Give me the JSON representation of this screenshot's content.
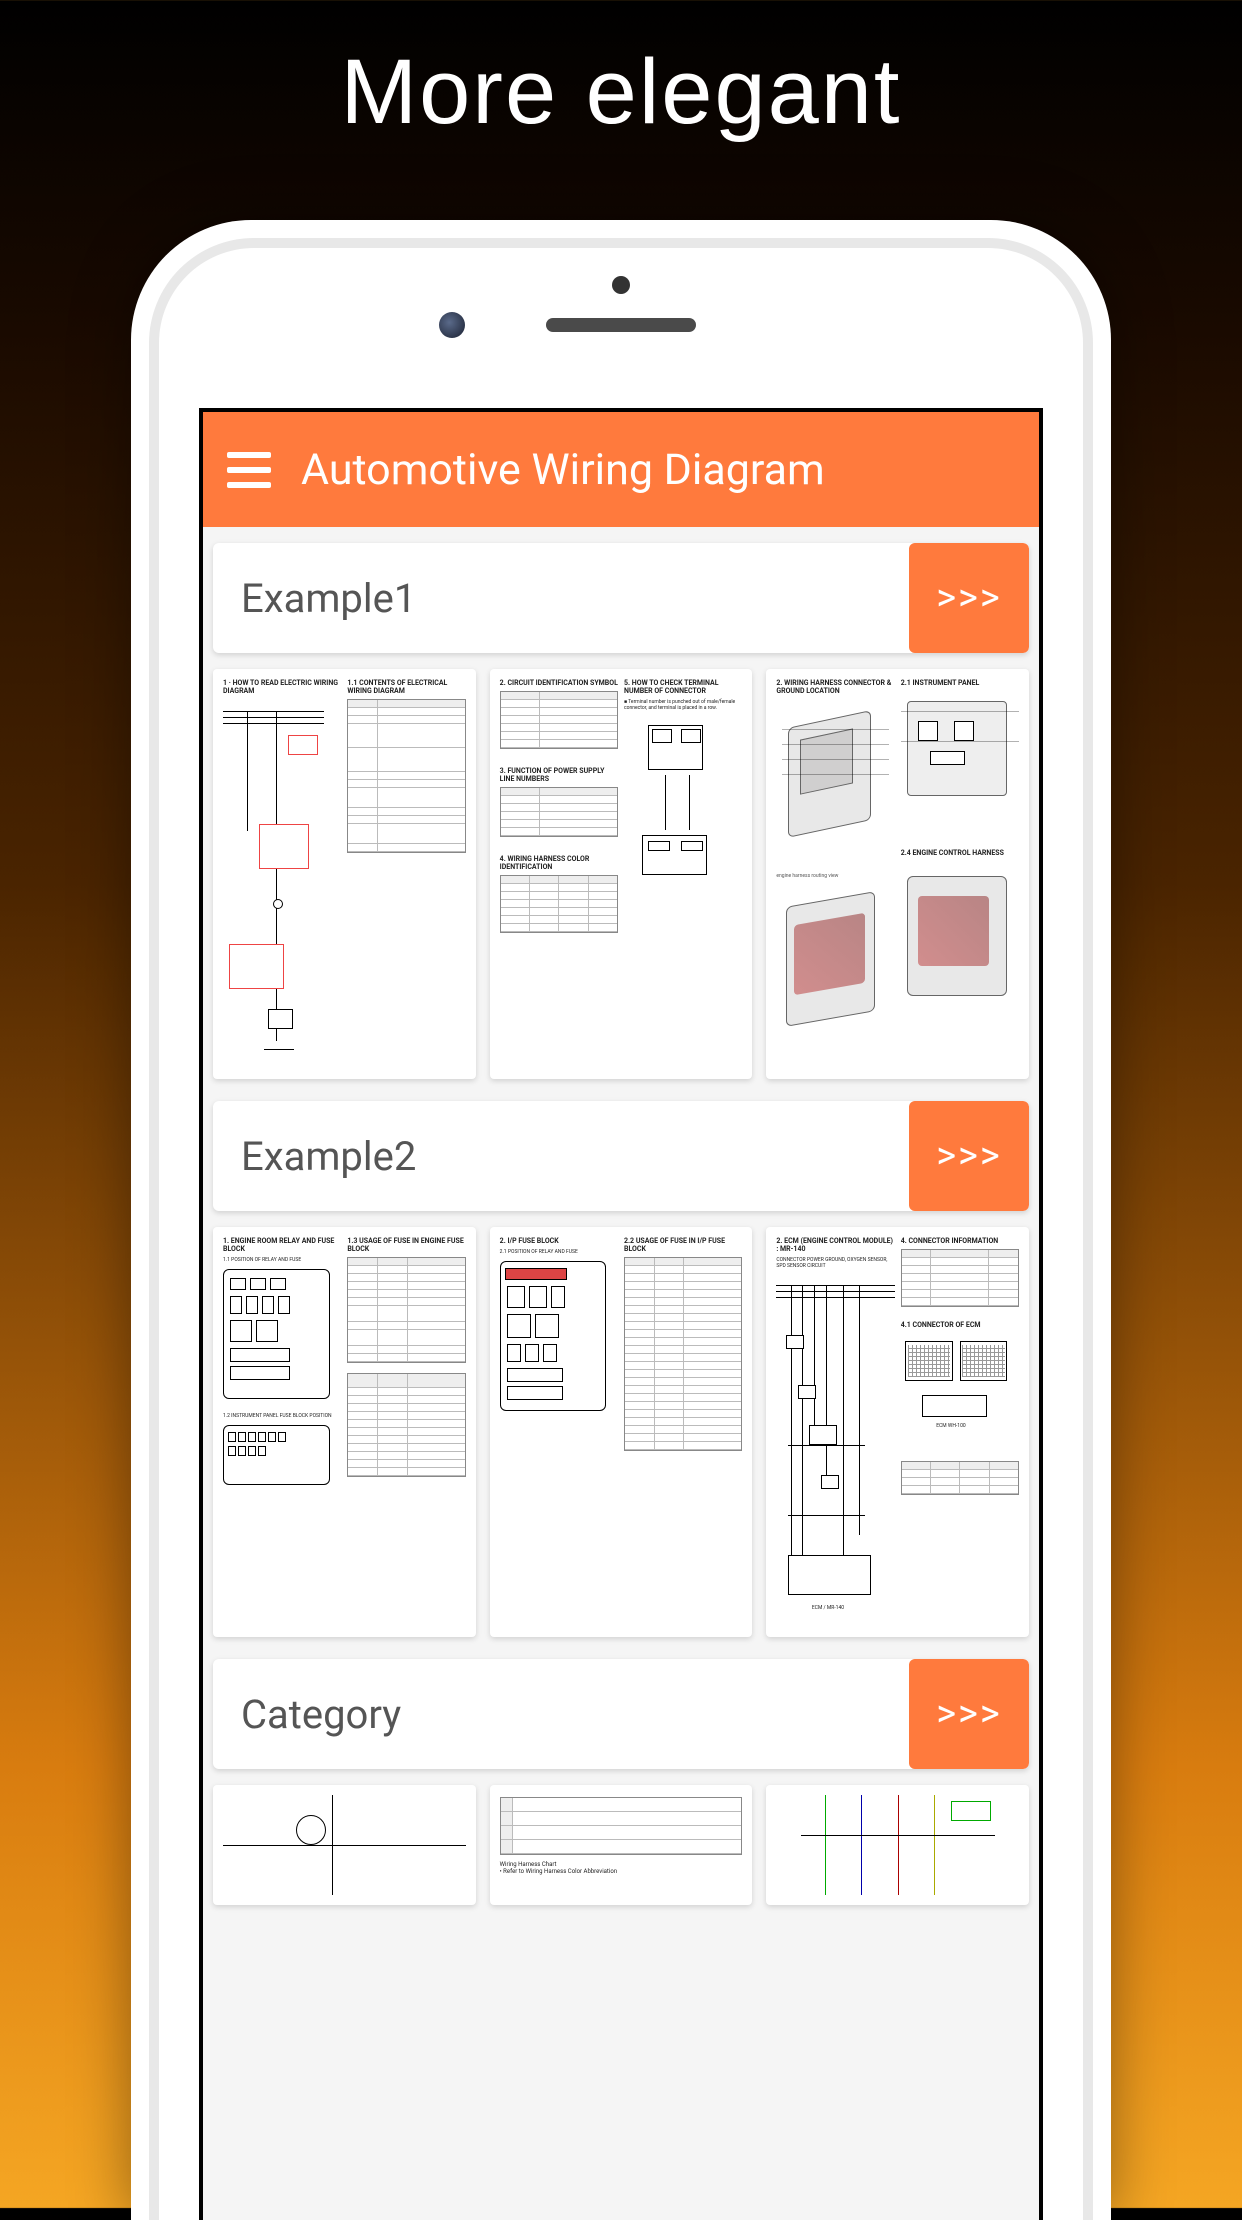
{
  "hero": {
    "text": "More elegant"
  },
  "app": {
    "title": "Automotive Wiring Diagram",
    "accent_color": "#ff7a3d"
  },
  "sections": [
    {
      "title": "Example1",
      "more_label": ">>>"
    },
    {
      "title": "Example2",
      "more_label": ">>>"
    },
    {
      "title": "Category",
      "more_label": ">>>"
    }
  ]
}
